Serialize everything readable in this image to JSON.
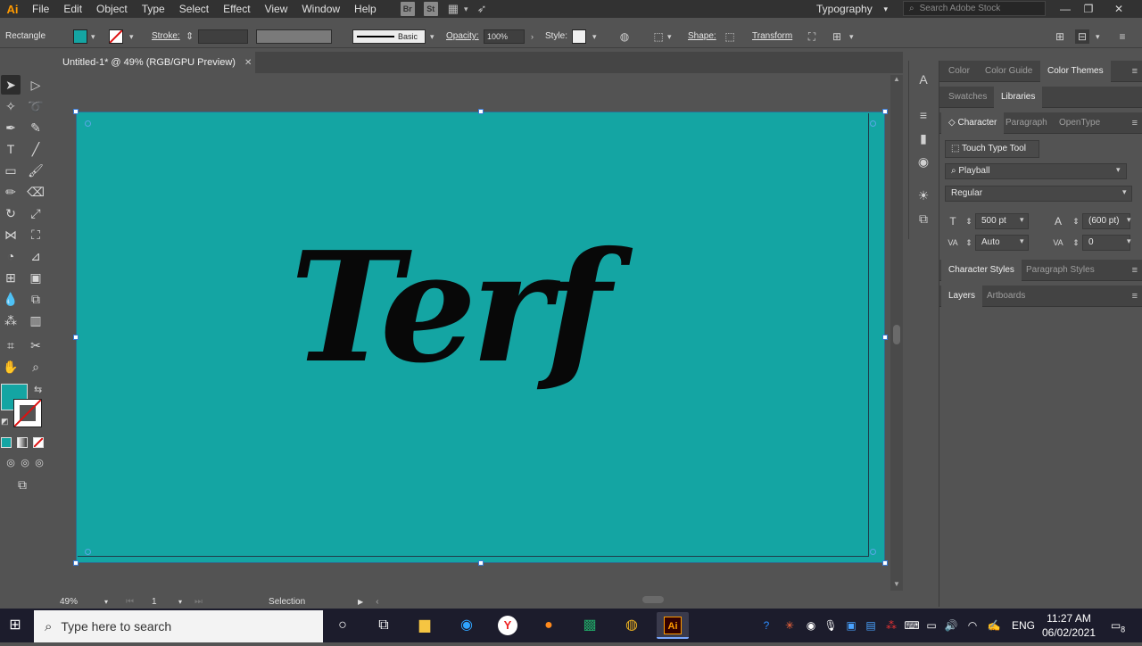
{
  "menubar": {
    "app_logo": "Ai",
    "items": [
      "File",
      "Edit",
      "Object",
      "Type",
      "Select",
      "Effect",
      "View",
      "Window",
      "Help"
    ],
    "bridge_icon": "Br",
    "stock_icon": "St",
    "workspace": "Typography",
    "search_placeholder": "Search Adobe Stock"
  },
  "controlbar": {
    "selection_type": "Rectangle",
    "fill_color": "#14a5a3",
    "stroke_label": "Stroke:",
    "brush_label": "Basic",
    "opacity_label": "Opacity:",
    "opacity_value": "100%",
    "style_label": "Style:",
    "shape_label": "Shape:",
    "transform_label": "Transform"
  },
  "document": {
    "tab_title": "Untitled-1* @ 49% (RGB/GPU Preview)",
    "close_glyph": "✕",
    "artboard_color": "#14a5a3",
    "art_text": "Terf"
  },
  "statusbar": {
    "zoom": "49%",
    "artboard_num": "1",
    "tool_status": "Selection"
  },
  "panel": {
    "tabs_row1": [
      "Color",
      "Color Guide",
      "Color Themes"
    ],
    "tabs_row2": [
      "Swatches",
      "Libraries"
    ],
    "tabs_row3": [
      "Character",
      "Paragraph",
      "OpenType"
    ],
    "touch_type_label": "Touch Type Tool",
    "font_family": "Playball",
    "font_style": "Regular",
    "font_size": "500 pt",
    "leading": "(600 pt)",
    "kerning": "Auto",
    "tracking": "0",
    "tabs_row4": [
      "Character Styles",
      "Paragraph Styles"
    ],
    "tabs_row5": [
      "Layers",
      "Artboards"
    ]
  },
  "taskbar": {
    "search_placeholder": "Type here to search",
    "language": "ENG",
    "time": "11:27 AM",
    "date": "06/02/2021",
    "notification_count": "8"
  }
}
